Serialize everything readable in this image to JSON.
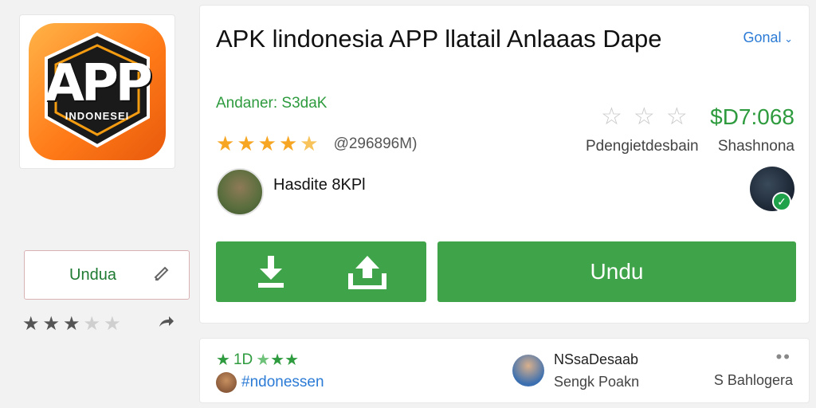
{
  "app": {
    "title": "APK lindonesia APP llatail Anlaaas Dape",
    "icon_text": "APP",
    "icon_subtext": "INDONESEI",
    "author": "Andaner: S3daK",
    "rating_stars": 4.5,
    "rating_count": "@296896M)",
    "price": "$D7:068",
    "meta_left": "Pdengietdesbain",
    "meta_right": "Shashnona",
    "developer_name": "Hasdite 8KPl"
  },
  "header": {
    "sort_label": "Gonal"
  },
  "sidebar": {
    "button_label": "Undua",
    "stars_filled": 3,
    "stars_total": 5
  },
  "actions": {
    "download_label": "Undu"
  },
  "review": {
    "score": "1D",
    "user": "#ndonessen",
    "name": "NSsaDesaab",
    "subtitle": "Sengk Poakn",
    "date": "S Bahlogera"
  },
  "colors": {
    "accent_green": "#3fa449",
    "link_blue": "#2b7bd6",
    "star_orange": "#f6a623"
  },
  "icons": [
    "download-icon",
    "upload-icon",
    "share-icon",
    "edit-icon",
    "check-icon",
    "more-icon"
  ]
}
